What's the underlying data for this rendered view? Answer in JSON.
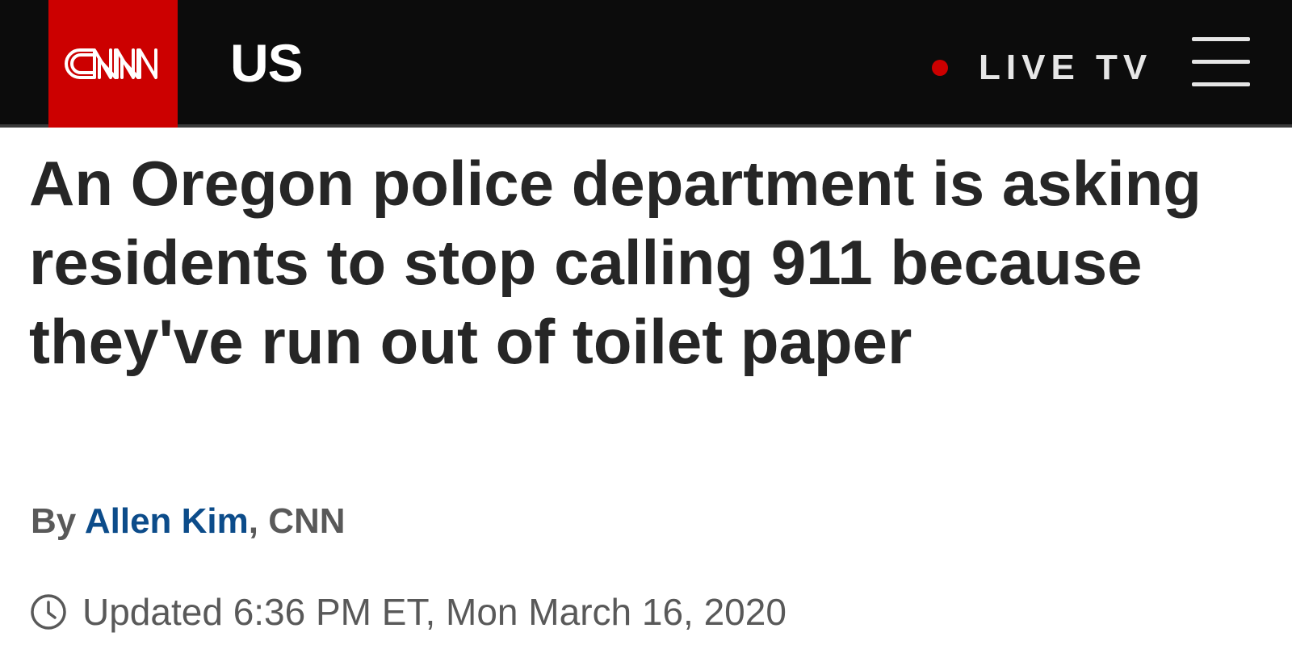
{
  "header": {
    "logo_text": "CNN",
    "section": "US",
    "live_tv_label": "LIVE TV",
    "brand_color": "#cc0000",
    "menu_icon": "hamburger-menu-icon"
  },
  "article": {
    "headline": "An Oregon police department is asking residents to stop calling 911 because they've run out of toilet paper",
    "byline_prefix": "By",
    "author": "Allen Kim",
    "byline_suffix": ", CNN",
    "timestamp": "Updated 6:36 PM ET, Mon March 16, 2020",
    "author_link_color": "#0c4c8a"
  }
}
